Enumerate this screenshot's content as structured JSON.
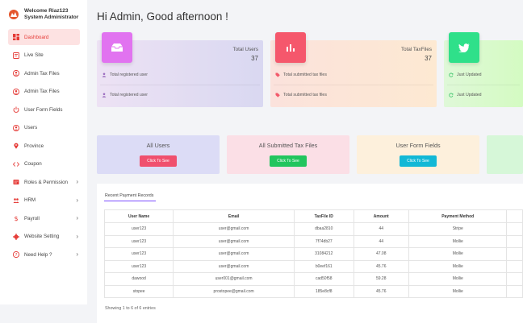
{
  "brand": {
    "line1": "Welcome Riaz123",
    "line2": "System Administrator"
  },
  "sidebar": {
    "items": [
      {
        "label": "Dashboard",
        "icon": "dashboard-icon",
        "active": true,
        "chevron": false
      },
      {
        "label": "Live Site",
        "icon": "globe-icon",
        "chevron": false
      },
      {
        "label": "Admin Tax Files",
        "icon": "user-circle-icon",
        "chevron": false
      },
      {
        "label": "Admin Tax Files",
        "icon": "user-circle-icon",
        "chevron": false
      },
      {
        "label": "User Form Fields",
        "icon": "power-icon",
        "chevron": false
      },
      {
        "label": "Users",
        "icon": "user-circle-icon",
        "chevron": false
      },
      {
        "label": "Province",
        "icon": "location-pin-icon",
        "chevron": false
      },
      {
        "label": "Coupon",
        "icon": "code-icon",
        "chevron": false
      },
      {
        "label": "Roles & Permission",
        "icon": "roles-icon",
        "chevron": true
      },
      {
        "label": "HRM",
        "icon": "hrm-icon",
        "chevron": true
      },
      {
        "label": "Payroll",
        "icon": "dollar-icon",
        "chevron": true
      },
      {
        "label": "Website Setting",
        "icon": "gear-icon",
        "chevron": true
      },
      {
        "label": "Need Help ?",
        "icon": "help-icon",
        "chevron": true
      }
    ]
  },
  "greeting": "Hi Admin, Good afternoon !",
  "stats": [
    {
      "title": "Total Users",
      "value": "37",
      "line1": "Total registered user",
      "line2": "Total registered user",
      "icon": "inbox-icon"
    },
    {
      "title": "Total TaxFiles",
      "value": "37",
      "line1": "Total submitted tax files",
      "line2": "Total submitted tax files",
      "icon": "bar-chart-icon"
    },
    {
      "title": "",
      "value": "",
      "line1": "Just Updated",
      "line2": "Just Updated",
      "icon": "twitter-icon"
    }
  ],
  "quick": [
    {
      "title": "All Users",
      "button": "Click To See"
    },
    {
      "title": "All Submitted Tax Files",
      "button": "Click To See"
    },
    {
      "title": "User Form Fields",
      "button": "Click To See"
    }
  ],
  "payments": {
    "tab": "Recent Payment Records",
    "columns": [
      "User Name",
      "Email",
      "TaxFile ID",
      "Amount",
      "Payment Method"
    ],
    "rows": [
      [
        "user123",
        "user@gmail.com",
        "dbaa2810",
        "44",
        "Stripe"
      ],
      [
        "user123",
        "user@gmail.com",
        "7f74db27",
        "44",
        "Mollie"
      ],
      [
        "user123",
        "user@gmail.com",
        "31084212",
        "47.08",
        "Mollie"
      ],
      [
        "user123",
        "user@gmail.com",
        "b0eef161",
        "45.76",
        "Mollie"
      ],
      [
        "dawood",
        "user001@gmail.com",
        "cad50f58",
        "59.28",
        "Mollie"
      ],
      [
        "stopee",
        "prostopee@gmail.com",
        "185e8cf8",
        "45.76",
        "Mollie"
      ]
    ],
    "footer": "Showing 1 to 6 of 6 entries"
  },
  "colors": {
    "accent": "#e53935",
    "stat_users_icon": "#e173f0",
    "stat_taxfiles_icon": "#f5576c",
    "stat_updated_icon": "#2fe08a",
    "btn_red": "#f0506e",
    "btn_green": "#22c55e",
    "btn_cyan": "#12b8d6"
  }
}
